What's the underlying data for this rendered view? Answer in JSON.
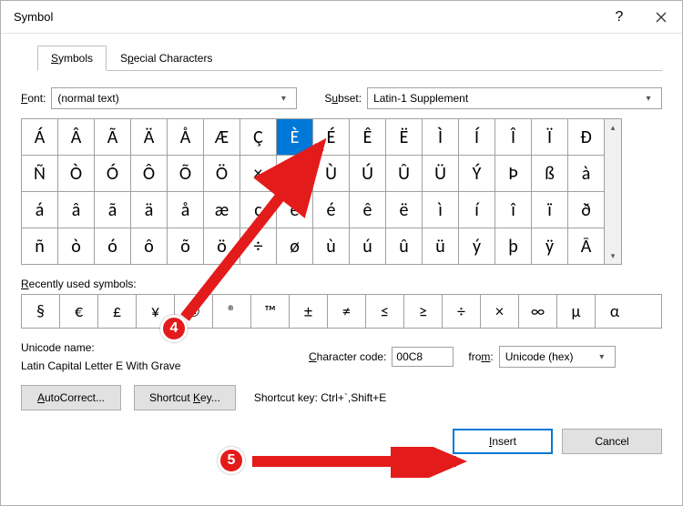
{
  "title": "Symbol",
  "tabs": {
    "symbols": "Symbols",
    "special": "Special Characters"
  },
  "font_label": "Font:",
  "font_value": "(normal text)",
  "subset_label": "Subset:",
  "subset_value": "Latin-1 Supplement",
  "grid": [
    [
      "Á",
      "Â",
      "Ã",
      "Ä",
      "Å",
      "Æ",
      "Ç",
      "È",
      "É",
      "Ê",
      "Ë",
      "Ì",
      "Í",
      "Î",
      "Ï",
      "Ð"
    ],
    [
      "Ñ",
      "Ò",
      "Ó",
      "Ô",
      "Õ",
      "Ö",
      "×",
      "Ø",
      "Ù",
      "Ú",
      "Û",
      "Ü",
      "Ý",
      "Þ",
      "ß",
      "à"
    ],
    [
      "á",
      "â",
      "ã",
      "ä",
      "å",
      "æ",
      "ç",
      "è",
      "é",
      "ê",
      "ë",
      "ì",
      "í",
      "î",
      "ï",
      "ð"
    ],
    [
      "ñ",
      "ò",
      "ó",
      "ô",
      "õ",
      "ö",
      "÷",
      "ø",
      "ù",
      "ú",
      "û",
      "ü",
      "ý",
      "þ",
      "ÿ",
      "Ā"
    ]
  ],
  "selected": {
    "row": 0,
    "col": 7
  },
  "recent_label": "Recently used symbols:",
  "recent": [
    "§",
    "€",
    "£",
    "¥",
    "©",
    "®",
    "™",
    "±",
    "≠",
    "≤",
    "≥",
    "÷",
    "×",
    "∞",
    "µ",
    "α"
  ],
  "unicode_name_label": "Unicode name:",
  "unicode_name_value": "Latin Capital Letter E With Grave",
  "charcode_label": "Character code:",
  "charcode_value": "00C8",
  "from_label": "from:",
  "from_value": "Unicode (hex)",
  "autocorrect_label": "AutoCorrect...",
  "shortcutkey_button": "Shortcut Key...",
  "shortcutkey_label": "Shortcut key:",
  "shortcutkey_value": "Ctrl+`,Shift+E",
  "insert_label": "Insert",
  "cancel_label": "Cancel",
  "annotations": {
    "badge4": "4",
    "badge5": "5"
  }
}
